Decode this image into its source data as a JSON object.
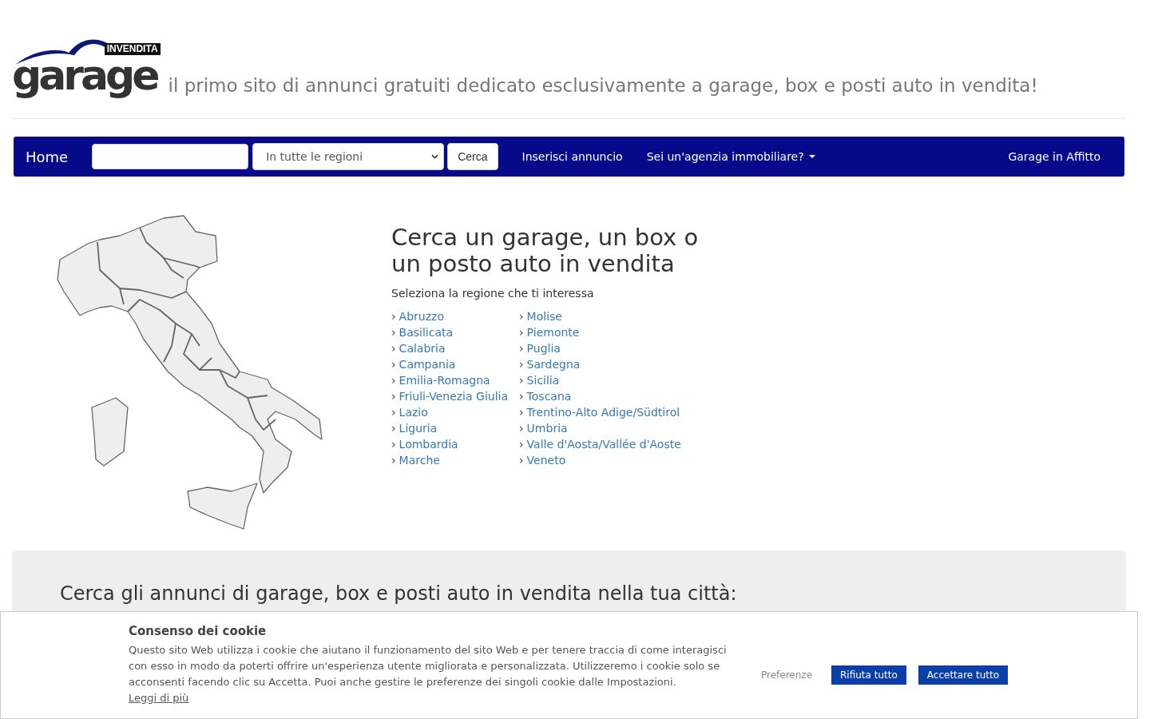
{
  "header": {
    "logo": {
      "badge": "INVENDITA",
      "word": "garage"
    },
    "tagline": "il primo sito di annunci gratuiti dedicato esclusivamente a garage, box e posti auto in vendita!"
  },
  "navbar": {
    "brand": "Home",
    "region_select": {
      "value": "In tutte le regioni"
    },
    "search_button": "Cerca",
    "links": [
      {
        "label": "Inserisci annuncio",
        "kind": "link"
      },
      {
        "label": "Sei un'agenzia immobiliare?",
        "kind": "dropdown"
      }
    ],
    "right_link": "Garage in Affitto"
  },
  "regions": {
    "title": "Cerca un garage, un box o un posto auto in vendita",
    "subtitle": "Seleziona la regione che ti interessa",
    "columns": [
      [
        {
          "marker": "›",
          "label": "Abruzzo"
        },
        {
          "marker": "›",
          "label": "Basilicata"
        },
        {
          "marker": "›",
          "label": "Calabria"
        },
        {
          "marker": "›",
          "label": "Campania"
        },
        {
          "marker": "›",
          "label": "Emilia-Romagna"
        },
        {
          "marker": "›",
          "label": "Friuli-Venezia Giulia"
        },
        {
          "marker": "›",
          "label": "Lazio"
        },
        {
          "marker": "›",
          "label": "Liguria"
        },
        {
          "marker": "›",
          "label": "Lombardia"
        },
        {
          "marker": "›",
          "label": "Marche"
        }
      ],
      [
        {
          "marker": "›",
          "label": "Molise"
        },
        {
          "marker": "›",
          "label": "Piemonte"
        },
        {
          "marker": "›",
          "label": "Puglia"
        },
        {
          "marker": "›",
          "label": "Sardegna"
        },
        {
          "marker": "›",
          "label": "Sicilia"
        },
        {
          "marker": "›",
          "label": "Toscana"
        },
        {
          "marker": "›",
          "label": "Trentino-Alto Adige/Südtirol"
        },
        {
          "marker": "›",
          "label": "Umbria"
        },
        {
          "marker": "›",
          "label": "Valle d'Aosta/Vallée d'Aoste"
        },
        {
          "marker": "›",
          "label": "Veneto"
        }
      ]
    ]
  },
  "cities": {
    "title": "Cerca gli annunci di garage, box e posti auto in vendita nella tua città:"
  },
  "cookie_banner": {
    "title": "Consenso dei cookie",
    "text": "Questo sito Web utilizza i cookie che aiutano il funzionamento del sito Web e per tenere traccia di come interagisci con esso in modo da poterti offrire un'esperienza utente migliorata e personalizzata. Utilizzeremo i cookie solo se acconsenti facendo clic su Accetta. Puoi anche gestire le preferenze dei singoli cookie dalle Impostazioni.",
    "link": "Leggi di più",
    "buttons": [
      {
        "label": "Preferenze",
        "kind": "plain"
      },
      {
        "label": "Rifiuta tutto",
        "kind": "primary"
      },
      {
        "label": "Accettare tutto",
        "kind": "primary"
      }
    ]
  }
}
